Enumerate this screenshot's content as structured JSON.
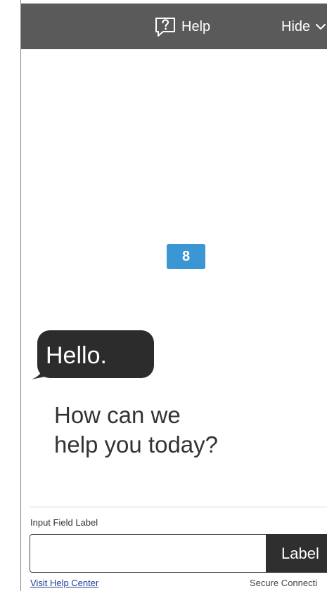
{
  "header": {
    "help_label": "Help",
    "help_icon": "help-icon",
    "hide_label": "Hide",
    "hide_icon": "chevron-down-icon"
  },
  "notification": {
    "count": "8",
    "color": "#3b97d3"
  },
  "chat": {
    "greeting": "Hello.",
    "prompt_line_1": "How can we",
    "prompt_line_2": "help you today?"
  },
  "form": {
    "input_label": "Input Field Label",
    "input_value": "",
    "submit_label": "Label"
  },
  "footer": {
    "help_center_link": "Visit Help Center",
    "connection_status": "Secure Connecti"
  }
}
